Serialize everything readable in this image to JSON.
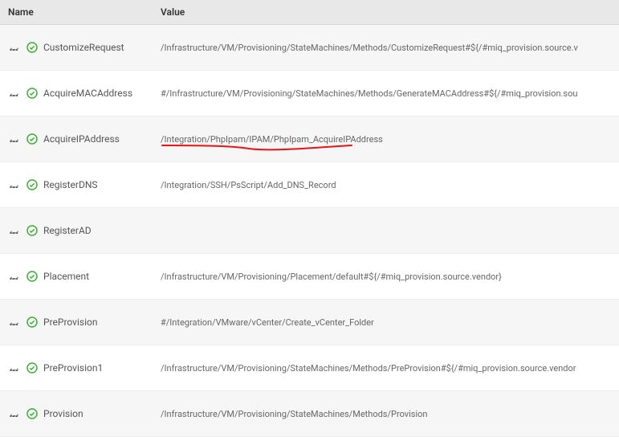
{
  "columns": {
    "name": "Name",
    "value": "Value"
  },
  "icons": {
    "cog": "gear-icon",
    "check": "checkmark-icon"
  },
  "rows": [
    {
      "name": "CustomizeRequest",
      "value": "/Infrastructure/VM/Provisioning/StateMachines/Methods/CustomizeRequest#${/#miq_provision.source.v",
      "annotated": false
    },
    {
      "name": "AcquireMACAddress",
      "value": "#/Infrastructure/VM/Provisioning/StateMachines/Methods/GenerateMACAddress#${/#miq_provision.sou",
      "annotated": false
    },
    {
      "name": "AcquireIPAddress",
      "value": "/Integration/PhpIpam/IPAM/PhpIpam_AcquireIPAddress",
      "annotated": true
    },
    {
      "name": "RegisterDNS",
      "value": "/Integration/SSH/PsScript/Add_DNS_Record",
      "annotated": false
    },
    {
      "name": "RegisterAD",
      "value": "",
      "annotated": false
    },
    {
      "name": "Placement",
      "value": "/Infrastructure/VM/Provisioning/Placement/default#${/#miq_provision.source.vendor}",
      "annotated": false
    },
    {
      "name": "PreProvision",
      "value": "#/Integration/VMware/vCenter/Create_vCenter_Folder",
      "annotated": false
    },
    {
      "name": "PreProvision1",
      "value": "/Infrastructure/VM/Provisioning/StateMachines/Methods/PreProvision#${/#miq_provision.source.vendor",
      "annotated": false
    },
    {
      "name": "Provision",
      "value": "/Infrastructure/VM/Provisioning/StateMachines/Methods/Provision",
      "annotated": false
    }
  ]
}
